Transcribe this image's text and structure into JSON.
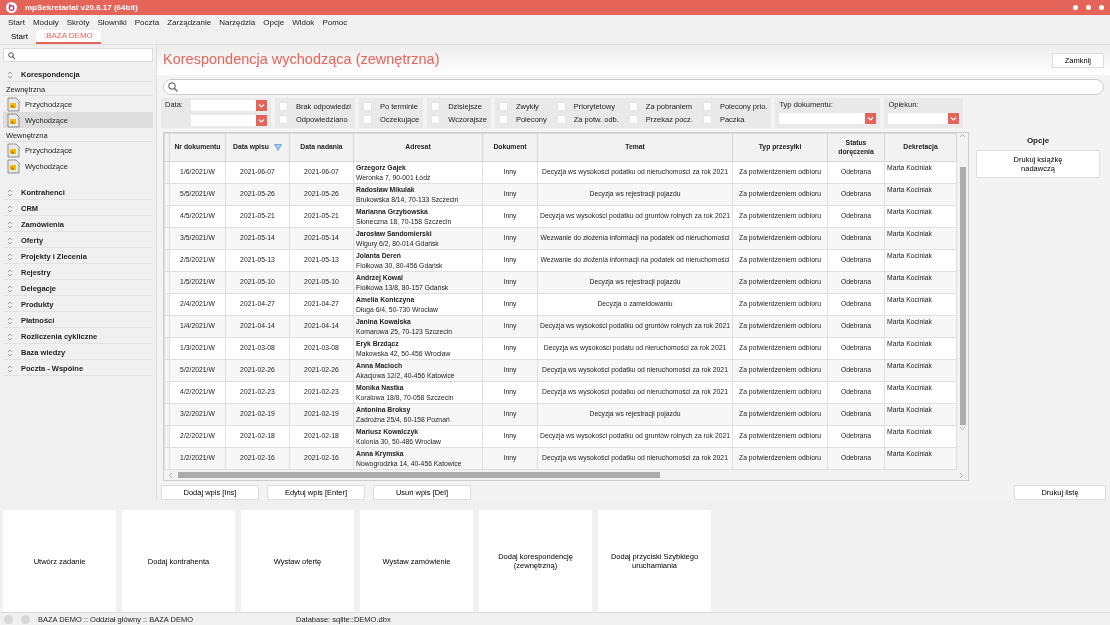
{
  "window": {
    "title": "mpSekretariat v20.6.17 (64bit)"
  },
  "menu": [
    "Start",
    "Moduły",
    "Skróty",
    "Słowniki",
    "Poczta",
    "Zarządzanie",
    "Narzędzia",
    "Opcje",
    "Widok",
    "Pomoc"
  ],
  "tabs": [
    {
      "label": "Start",
      "selected": false
    },
    {
      "label": ":BAZA DEMO",
      "selected": true
    }
  ],
  "sidebar": {
    "sections": [
      {
        "label": "Korespondencja",
        "groups": [
          {
            "label": "Zewnętrzna",
            "items": [
              {
                "label": "Przychodzące",
                "selected": false
              },
              {
                "label": "Wychodzące",
                "selected": true
              }
            ]
          },
          {
            "label": "Wewnętrzna",
            "items": [
              {
                "label": "Przychodzące",
                "selected": false
              },
              {
                "label": "Wychodzące",
                "selected": false
              }
            ]
          }
        ]
      },
      {
        "label": "Kontrahenci"
      },
      {
        "label": "CRM"
      },
      {
        "label": "Zamówienia"
      },
      {
        "label": "Oferty"
      },
      {
        "label": "Projekty i Zlecenia"
      },
      {
        "label": "Rejestry"
      },
      {
        "label": "Delegacje"
      },
      {
        "label": "Produkty"
      },
      {
        "label": "Płatności"
      },
      {
        "label": "Rozliczenia cykliczne"
      },
      {
        "label": "Baza wiedzy"
      },
      {
        "label": "Poczta - Wspólne"
      }
    ]
  },
  "page": {
    "title": "Korespondencja wychodząca (zewnętrzna)",
    "close_button": "Zamknij"
  },
  "filters": {
    "date_label": "Data:",
    "checkbox_groups": [
      [
        {
          "label": "Brak odpowiedzi",
          "checked": false
        },
        {
          "label": "Odpowiedziano",
          "checked": false
        }
      ],
      [
        {
          "label": "Po terminie",
          "checked": false
        },
        {
          "label": "Oczekujące",
          "checked": false
        }
      ],
      [
        {
          "label": "Dzisiejsze",
          "checked": false
        },
        {
          "label": "Wczorajsze",
          "checked": false
        }
      ],
      [
        {
          "label": "Zwykły",
          "checked": false
        },
        {
          "label": "Polecony",
          "checked": false
        },
        {
          "label": "Priorytetowy",
          "checked": false
        },
        {
          "label": "Za potw. odb.",
          "checked": false
        },
        {
          "label": "Za pobraniem",
          "checked": false
        },
        {
          "label": "Przekaz pocz.",
          "checked": false
        },
        {
          "label": "Polecony prio.",
          "checked": false
        },
        {
          "label": "Paczka",
          "checked": false
        }
      ]
    ],
    "dropdowns": [
      {
        "label": "Typ dokumentu:"
      },
      {
        "label": "Opiekun:"
      }
    ]
  },
  "table": {
    "columns": [
      {
        "label": "Nr dokumentu",
        "sorted": false
      },
      {
        "label": "Data wpisu",
        "sorted": true
      },
      {
        "label": "Data nadania",
        "sorted": false
      },
      {
        "label": "Adresat",
        "sorted": false
      },
      {
        "label": "Dokument",
        "sorted": false
      },
      {
        "label": "Temat",
        "sorted": false
      },
      {
        "label": "Typ przesyłki",
        "sorted": false
      },
      {
        "label": "Status doręczenia",
        "sorted": false
      },
      {
        "label": "Dekretacja",
        "sorted": false
      }
    ],
    "rows": [
      {
        "nr": "1/6/2021/W",
        "data_wpisu": "2021-06-07",
        "data_nadania": "2021-06-07",
        "adresat": "Grzegorz Gajek",
        "adres": "Weronka 7, 90-001 Łódź",
        "dokument": "Inny",
        "temat": "Decyzja ws wysokości podatku od nieruchomości za rok 2021",
        "typ": "Za potwierdzeniem odbioru",
        "status": "Odebrana",
        "dekretacja": "Marta Kociniak"
      },
      {
        "nr": "5/5/2021/W",
        "data_wpisu": "2021-05-26",
        "data_nadania": "2021-05-26",
        "adresat": "Radosław Mikulak",
        "adres": "Brukowska 8/14, 70-133 Szczecin",
        "dokument": "Inny",
        "temat": "Decyzja ws rejestracji pojazdu",
        "typ": "Za potwierdzeniem odbioru",
        "status": "Odebrana",
        "dekretacja": "Marta Kociniak"
      },
      {
        "nr": "4/5/2021/W",
        "data_wpisu": "2021-05-21",
        "data_nadania": "2021-05-21",
        "adresat": "Marianna Grzybowska",
        "adres": "Słoneczna 18, 70-158 Szczecin",
        "dokument": "Inny",
        "temat": "Decyzja ws wysokości podatku od gruntów rolnych za rok 2021",
        "typ": "Za potwierdzeniem odbioru",
        "status": "Odebrana",
        "dekretacja": "Marta Kociniak"
      },
      {
        "nr": "3/5/2021/W",
        "data_wpisu": "2021-05-14",
        "data_nadania": "2021-05-14",
        "adresat": "Jarosław Sandomierski",
        "adres": "Wigury 6/2, 80-014 Gdańsk",
        "dokument": "Inny",
        "temat": "Wezwanie do złożenia informacji na podatek od nieruchomości",
        "typ": "Za potwierdzeniem odbioru",
        "status": "Odebrana",
        "dekretacja": "Marta Kociniak"
      },
      {
        "nr": "2/5/2021/W",
        "data_wpisu": "2021-05-13",
        "data_nadania": "2021-05-13",
        "adresat": "Jolanta Dereń",
        "adres": "Fiołkowa 30, 80-456 Gdańsk",
        "dokument": "Inny",
        "temat": "Wezwanie do złożenia informacji na podatek od nieruchomości",
        "typ": "Za potwierdzeniem odbioru",
        "status": "Odebrana",
        "dekretacja": "Marta Kociniak"
      },
      {
        "nr": "1/5/2021/W",
        "data_wpisu": "2021-05-10",
        "data_nadania": "2021-05-10",
        "adresat": "Andrzej Kowal",
        "adres": "Fiołkowa 13/8, 80-157 Gdańsk",
        "dokument": "Inny",
        "temat": "Decyzja ws rejestracji pojazdu",
        "typ": "Za potwierdzeniem odbioru",
        "status": "Odebrana",
        "dekretacja": "Marta Kociniak"
      },
      {
        "nr": "2/4/2021/W",
        "data_wpisu": "2021-04-27",
        "data_nadania": "2021-04-27",
        "adresat": "Amelia Koniczyna",
        "adres": "Długa 6/4, 50-730 Wrocław",
        "dokument": "Inny",
        "temat": "Decyzja o zameldowaniu",
        "typ": "Za potwierdzeniem odbioru",
        "status": "Odebrana",
        "dekretacja": "Marta Kociniak"
      },
      {
        "nr": "1/4/2021/W",
        "data_wpisu": "2021-04-14",
        "data_nadania": "2021-04-14",
        "adresat": "Janina Kowalska",
        "adres": "Komarowa 25, 70-123 Szczecin",
        "dokument": "Inny",
        "temat": "Decyzja ws wysokości podatku od gruntów rolnych za rok 2021",
        "typ": "Za potwierdzeniem odbioru",
        "status": "Odebrana",
        "dekretacja": "Marta Kociniak"
      },
      {
        "nr": "1/3/2021/W",
        "data_wpisu": "2021-03-08",
        "data_nadania": "2021-03-08",
        "adresat": "Eryk Brzdącz",
        "adres": "Makowska 42, 50-456 Wrocław",
        "dokument": "Inny",
        "temat": "Decyzja ws wysokości podatu od nieruchomości za rok 2021",
        "typ": "Za potwierdzeniem odbioru",
        "status": "Odebrana",
        "dekretacja": "Marta Kociniak"
      },
      {
        "nr": "5/2/2021/W",
        "data_wpisu": "2021-02-26",
        "data_nadania": "2021-02-26",
        "adresat": "Anna Macioch",
        "adres": "Akacjowa 12/2, 40-456 Katowice",
        "dokument": "Inny",
        "temat": "Decyzja ws wysokości podatku od nieruchomości za rok 2021",
        "typ": "Za potwierdzeniem odbioru",
        "status": "Odebrana",
        "dekretacja": "Marta Kociniak"
      },
      {
        "nr": "4/2/2021/W",
        "data_wpisu": "2021-02-23",
        "data_nadania": "2021-02-23",
        "adresat": "Monika Nastka",
        "adres": "Koralowa 18/8, 70-058 Szczecin",
        "dokument": "Inny",
        "temat": "Decyzja ws wysokości podatku od nieruchomości za rok 2021",
        "typ": "Za potwierdzeniem odbioru",
        "status": "Odebrana",
        "dekretacja": "Marta Kociniak"
      },
      {
        "nr": "3/2/2021/W",
        "data_wpisu": "2021-02-19",
        "data_nadania": "2021-02-19",
        "adresat": "Antonina Broksy",
        "adres": "Zadrożna 25/4, 60-158 Poznań",
        "dokument": "Inny",
        "temat": "Decyzja ws rejestracji pojazdu",
        "typ": "Za potwierdzeniem odbioru",
        "status": "Odebrana",
        "dekretacja": "Marta Kociniak"
      },
      {
        "nr": "2/2/2021/W",
        "data_wpisu": "2021-02-18",
        "data_nadania": "2021-02-18",
        "adresat": "Mariusz Kowalczyk",
        "adres": "Kolonia 30, 50-486 Wrocław",
        "dokument": "Inny",
        "temat": "Decyzja ws wysokości podatku od gruntów rolnych za rok 2021",
        "typ": "Za potwierdzeniem odbioru",
        "status": "Odebrana",
        "dekretacja": "Marta Kociniak"
      },
      {
        "nr": "1/2/2021/W",
        "data_wpisu": "2021-02-16",
        "data_nadania": "2021-02-16",
        "adresat": "Anna Krymska",
        "adres": "Nowogrodzka 14, 40-456 Katowice",
        "dokument": "Inny",
        "temat": "Decyzja ws wysokości podatku od nieruchomości za rok 2021",
        "typ": "Za potwierdzeniem odbioru",
        "status": "Odebrana",
        "dekretacja": "Marta Kociniak"
      }
    ]
  },
  "table_buttons": [
    "Dodaj wpis [Ins]",
    "Edytuj wpis [Enter]",
    "Usuń wpis [Del]"
  ],
  "print_button": "Drukuj listę",
  "options": {
    "title": "Opcje",
    "buttons": [
      "Drukuj książkę nadawczą"
    ]
  },
  "tiles": [
    "Utwórz zadanie",
    "Dodaj kontrahenta",
    "Wystaw ofertę",
    "Wystaw zamówienie",
    "Dodaj korespondencję (zewnętrzną)",
    "Dodaj przyciski Szybkiego uruchamiania"
  ],
  "status_bar": {
    "session": "BAZA DEMO :: Oddział główny :: BAZA DEMO",
    "database": "Database: sqlite::DEMO.dbx"
  }
}
